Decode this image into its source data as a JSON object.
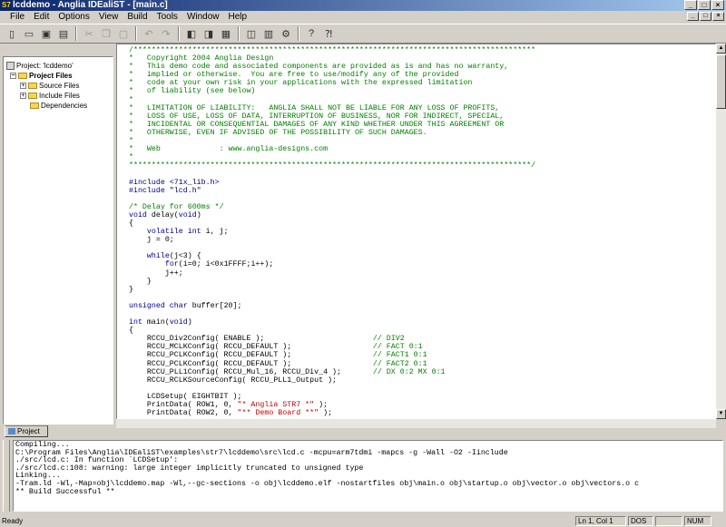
{
  "window": {
    "title": "lcddemo - Anglia IDEaliST - [main.c]",
    "controls": [
      "_",
      "□",
      "×"
    ]
  },
  "menu": [
    "File",
    "Edit",
    "Options",
    "View",
    "Build",
    "Tools",
    "Window",
    "Help"
  ],
  "toolbar": {
    "buttons": [
      "new-file-icon",
      "open-folder-icon",
      "save-icon",
      "window-list-icon",
      "cut-icon",
      "copy-icon",
      "paste-icon",
      "undo-icon",
      "redo-icon",
      "compile-icon",
      "build-icon",
      "rebuild-icon",
      "stop-build-icon",
      "download-icon",
      "debug-icon",
      "help-icon",
      "context-help-icon"
    ]
  },
  "project": {
    "root": "Project: 'lcddemo'",
    "files_label": "Project Files",
    "source_files": "Source Files",
    "include_files": "Include Files",
    "dependencies": "Dependencies",
    "tab_label": "Project"
  },
  "editor": {
    "filename": "main.c",
    "lines": [
      [
        [
          "c",
          "/*****************************************************************************************"
        ]
      ],
      [
        [
          "c",
          "*   Copyright 2004 Anglia Design"
        ]
      ],
      [
        [
          "c",
          "*   This demo code and associated components are provided as is and has no warranty,"
        ]
      ],
      [
        [
          "c",
          "*   implied or otherwise.  You are free to use/modify any of the provided"
        ]
      ],
      [
        [
          "c",
          "*   code at your own risk in your applications with the expressed limitation"
        ]
      ],
      [
        [
          "c",
          "*   of liability (see below)"
        ]
      ],
      [
        [
          "c",
          "*"
        ]
      ],
      [
        [
          "c",
          "*   LIMITATION OF LIABILITY:   ANGLIA SHALL NOT BE LIABLE FOR ANY LOSS OF PROFITS,"
        ]
      ],
      [
        [
          "c",
          "*   LOSS OF USE, LOSS OF DATA, INTERRUPTION OF BUSINESS, NOR FOR INDIRECT, SPECIAL,"
        ]
      ],
      [
        [
          "c",
          "*   INCIDENTAL OR CONSEQUENTIAL DAMAGES OF ANY KIND WHETHER UNDER THIS AGREEMENT OR"
        ]
      ],
      [
        [
          "c",
          "*   OTHERWISE, EVEN IF ADVISED OF THE POSSIBILITY OF SUCH DAMAGES."
        ]
      ],
      [
        [
          "c",
          "*"
        ]
      ],
      [
        [
          "c",
          "*   Web             : www.anglia-designs.com"
        ]
      ],
      [
        [
          "c",
          "*"
        ]
      ],
      [
        [
          "c",
          "*****************************************************************************************/"
        ]
      ],
      [],
      [
        [
          "p",
          "#include <71x_lib.h>"
        ]
      ],
      [
        [
          "p",
          "#include \"lcd.h\""
        ]
      ],
      [],
      [
        [
          "c",
          "/* Delay for 600ms */"
        ]
      ],
      [
        [
          "k",
          "void"
        ],
        [
          "n",
          " delay("
        ],
        [
          "k",
          "void"
        ],
        [
          "n",
          ")"
        ]
      ],
      [
        [
          "n",
          "{"
        ]
      ],
      [
        [
          "n",
          "    "
        ],
        [
          "k",
          "volatile int"
        ],
        [
          "n",
          " i, j;"
        ]
      ],
      [
        [
          "n",
          "    j = 0;"
        ]
      ],
      [],
      [
        [
          "n",
          "    "
        ],
        [
          "k",
          "while"
        ],
        [
          "n",
          "(j<3) {"
        ]
      ],
      [
        [
          "n",
          "        "
        ],
        [
          "k",
          "for"
        ],
        [
          "n",
          "(i=0; i<0x1FFFF;i++);"
        ]
      ],
      [
        [
          "n",
          "        j++;"
        ]
      ],
      [
        [
          "n",
          "    }"
        ]
      ],
      [
        [
          "n",
          "}"
        ]
      ],
      [],
      [
        [
          "k",
          "unsigned char"
        ],
        [
          "n",
          " buffer[20];"
        ]
      ],
      [],
      [
        [
          "k",
          "int"
        ],
        [
          "n",
          " main("
        ],
        [
          "k",
          "void"
        ],
        [
          "n",
          ")"
        ]
      ],
      [
        [
          "n",
          "{"
        ]
      ],
      [
        [
          "n",
          "    RCCU_Div2Config( ENABLE );                        "
        ],
        [
          "c",
          "// DIV2"
        ]
      ],
      [
        [
          "n",
          "    RCCU_MCLKConfig( RCCU_DEFAULT );                  "
        ],
        [
          "c",
          "// FACT 0:1"
        ]
      ],
      [
        [
          "n",
          "    RCCU_PCLKConfig( RCCU_DEFAULT );                  "
        ],
        [
          "c",
          "// FACT1 0:1"
        ]
      ],
      [
        [
          "n",
          "    RCCU_PCLKConfig( RCCU_DEFAULT );                  "
        ],
        [
          "c",
          "// FACT2 0:1"
        ]
      ],
      [
        [
          "n",
          "    RCCU_PLL1Config( RCCU_Mul_16, RCCU_Div_4 );       "
        ],
        [
          "c",
          "// DX 0:2 MX 0:1"
        ]
      ],
      [
        [
          "n",
          "    RCCU_RCLKSourceConfig( RCCU_PLL1_Output );"
        ]
      ],
      [],
      [
        [
          "n",
          "    LCDSetup( EIGHTBIT );"
        ]
      ],
      [
        [
          "n",
          "    PrintData( ROW1, 0, "
        ],
        [
          "s",
          "\"* Anglia STR7 *\""
        ],
        [
          "n",
          " );"
        ]
      ],
      [
        [
          "n",
          "    PrintData( ROW2, 0, "
        ],
        [
          "s",
          "\"** Demo Board **\""
        ],
        [
          "n",
          " );"
        ]
      ]
    ]
  },
  "output": {
    "lines": [
      "Compiling...",
      "C:\\Program Files\\Anglia\\IDEaliST\\examples\\str7\\lcddemo\\src\\lcd.c -mcpu=arm7tdmi -mapcs -g -Wall -O2 -Iinclude",
      "./src/lcd.c: In function `LCDSetup':",
      "./src/lcd.c:108: warning: large integer implicitly truncated to unsigned type",
      "Linking...",
      "-Tram.ld -Wl,-Map=obj\\lcddemo.map -Wl,--gc-sections -o obj\\lcddemo.elf -nostartfiles obj\\main.o obj\\startup.o obj\\vector.o obj\\vectors.o c",
      "** Build Successful **"
    ]
  },
  "status": {
    "ready": "Ready",
    "position": "Ln 1, Col 1",
    "format": "DOS",
    "num": "NUM"
  },
  "colors": {
    "comment": "#008000",
    "keyword": "#00008b",
    "string": "#c00000",
    "preprocessor": "#000080",
    "titlebar_start": "#0a246a",
    "titlebar_end": "#a6caf0"
  }
}
